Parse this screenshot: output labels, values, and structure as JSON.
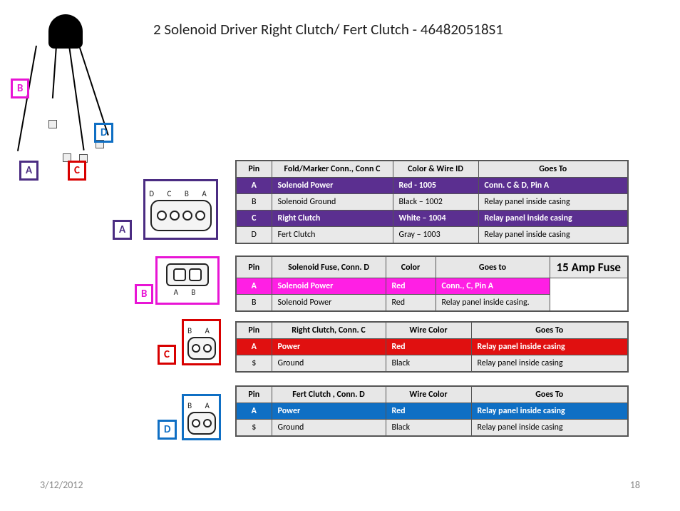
{
  "title": "2 Solenoid Driver Right Clutch/ Fert Clutch -  464820518S1",
  "tags": {
    "A": "A",
    "B": "B",
    "C": "C",
    "D": "D"
  },
  "connectors": {
    "A": {
      "pins_label": "D  C  B  A"
    },
    "B": {
      "pins_label": "A      B"
    },
    "C": {
      "pins_label": "B  A"
    },
    "D": {
      "pins_label": "B  A"
    }
  },
  "tableA": {
    "headers": [
      "Pin",
      "Fold/Marker Conn., Conn C",
      "Color & Wire ID",
      "Goes To"
    ],
    "rows": [
      {
        "hl": "purple",
        "cells": [
          "A",
          "Solenoid Power",
          "Red - 1005",
          "Conn. C & D, Pin A"
        ]
      },
      {
        "hl": "plain",
        "cells": [
          "B",
          "Solenoid Ground",
          "Black – 1002",
          "Relay panel inside casing"
        ]
      },
      {
        "hl": "purple",
        "cells": [
          "C",
          "Right Clutch",
          "White – 1004",
          "Relay panel inside casing"
        ]
      },
      {
        "hl": "plain",
        "cells": [
          "D",
          "Fert Clutch",
          "Gray – 1003",
          "Relay panel inside casing"
        ]
      }
    ]
  },
  "tableB": {
    "headers": [
      "Pin",
      "Solenoid Fuse, Conn. D",
      "Color",
      "Goes to"
    ],
    "fuse_label": "15 Amp Fuse",
    "rows": [
      {
        "hl": "magenta",
        "cells": [
          "A",
          "Solenoid Power",
          "Red",
          "Conn., C, Pin A"
        ]
      },
      {
        "hl": "plain",
        "cells": [
          "B",
          "Solenoid Power",
          "Red",
          "Relay panel inside casing."
        ]
      }
    ]
  },
  "tableC": {
    "headers": [
      "Pin",
      "Right Clutch, Conn. C",
      "Wire Color",
      "Goes To"
    ],
    "rows": [
      {
        "hl": "red",
        "cells": [
          "A",
          "Power",
          "Red",
          "Relay panel inside casing"
        ]
      },
      {
        "hl": "plain",
        "cells": [
          "$",
          "Ground",
          "Black",
          "Relay panel inside casing"
        ]
      }
    ]
  },
  "tableD": {
    "headers": [
      "Pin",
      "Fert Clutch ,  Conn. D",
      "Wire Color",
      "Goes To"
    ],
    "rows": [
      {
        "hl": "blue",
        "cells": [
          "A",
          "Power",
          "Red",
          "Relay panel inside casing"
        ]
      },
      {
        "hl": "plain",
        "cells": [
          "$",
          "Ground",
          "Black",
          "Relay panel inside casing"
        ]
      }
    ]
  },
  "footer": {
    "date": "3/12/2012",
    "page": "18"
  }
}
